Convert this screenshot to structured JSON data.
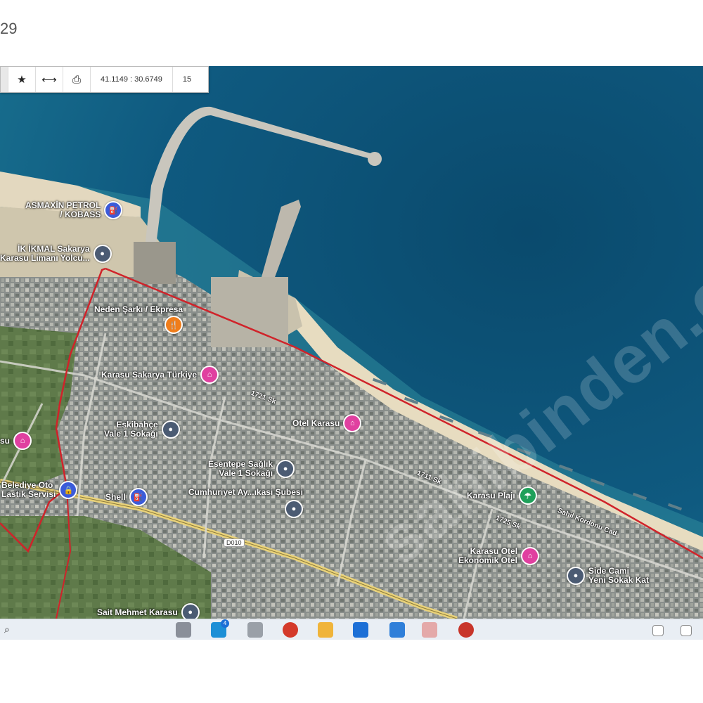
{
  "page": {
    "number_fragment": "29"
  },
  "toolbar": {
    "icons": [
      "star-icon",
      "measure-icon",
      "print-icon"
    ],
    "coordinates": "41.1149 : 30.6749",
    "zoom": "15"
  },
  "watermark": "sahibinden.com",
  "pois": {
    "asmaxin": {
      "line1": "ASMAXİN PETROL",
      "line2": "/ KOBASS"
    },
    "ik_ikmal": {
      "line1": "İK İKMAL Sakarya",
      "line2": "Karasu Limanı Yolcu..."
    },
    "neden": {
      "line1": "Neden Şarkı / Ekpresa"
    },
    "karasu_sakarya": {
      "line1": "Karasu Sakarya Türkiye"
    },
    "cumhuriyet": {
      "line1": "Eskibahçe",
      "line2": "Vale 1 Sokağı"
    },
    "otel_karasu": {
      "line1": "Otel Karasu"
    },
    "left_hotel": {
      "line1": "su"
    },
    "belediye": {
      "line1": "Belediye Oto",
      "line2": "Lastik Servisi"
    },
    "shell": {
      "line1": "Shell"
    },
    "esentepe": {
      "line1": "Esentepe Sağlık",
      "line2": "Vale 1 Sokağı"
    },
    "cumhuriyet2": {
      "line1": "Cumhuriyet Ay...ıkasi Şubesi"
    },
    "kamp_plaj": {
      "line1": "Karasu Plajı"
    },
    "karasu_otel": {
      "line1": "Karasu Otel",
      "line2": "Ekonomik Otel"
    },
    "side_cami": {
      "line1": "Side Cami",
      "line2": "Yeni Sokak Kat"
    },
    "sahil_label": {
      "line1": "Sahil Kordonu Cad."
    },
    "bottom_place": {
      "line1": "Sait Mehmet Karasu"
    }
  },
  "road_labels": [
    "1721 Sk",
    "1711 Sk",
    "1725 Sk"
  ],
  "road_badge": "D010",
  "taskbar": {
    "start_text": "⌕"
  },
  "colors": {
    "sea": "#0e4f72",
    "boundary": "#d0232a",
    "hotel_pin": "#e040a0",
    "place_pin": "#4b5b73",
    "fuel_pin": "#3b5bd9",
    "food_pin": "#f07d1a",
    "park_pin": "#1fa05a"
  }
}
